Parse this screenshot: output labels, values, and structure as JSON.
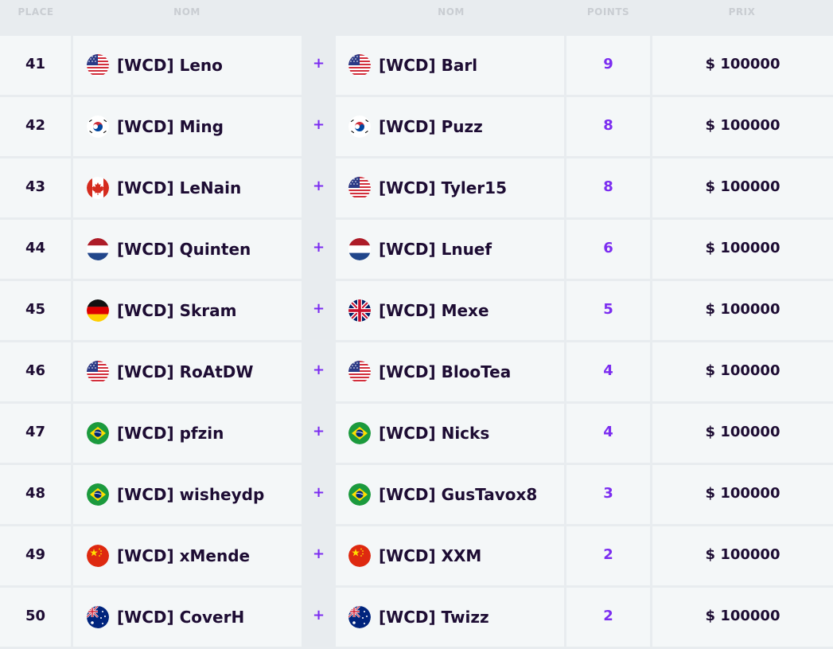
{
  "headers": {
    "place": "PLACE",
    "name1": "NOM",
    "name2": "NOM",
    "points": "POINTS",
    "prize": "PRIX"
  },
  "plus_symbol": "+",
  "rows": [
    {
      "place": "41",
      "p1": {
        "name": "[WCD] Leno",
        "flag": "us"
      },
      "p2": {
        "name": "[WCD] Barl",
        "flag": "us"
      },
      "points": "9",
      "prize": "$ 100000"
    },
    {
      "place": "42",
      "p1": {
        "name": "[WCD] Ming",
        "flag": "kr"
      },
      "p2": {
        "name": "[WCD] Puzz",
        "flag": "kr"
      },
      "points": "8",
      "prize": "$ 100000"
    },
    {
      "place": "43",
      "p1": {
        "name": "[WCD] LeNain",
        "flag": "ca"
      },
      "p2": {
        "name": "[WCD] Tyler15",
        "flag": "us"
      },
      "points": "8",
      "prize": "$ 100000"
    },
    {
      "place": "44",
      "p1": {
        "name": "[WCD] Quinten",
        "flag": "nl"
      },
      "p2": {
        "name": "[WCD] Lnuef",
        "flag": "nl"
      },
      "points": "6",
      "prize": "$ 100000"
    },
    {
      "place": "45",
      "p1": {
        "name": "[WCD] Skram",
        "flag": "de"
      },
      "p2": {
        "name": "[WCD] Mexe",
        "flag": "gb"
      },
      "points": "5",
      "prize": "$ 100000"
    },
    {
      "place": "46",
      "p1": {
        "name": "[WCD] RoAtDW",
        "flag": "us"
      },
      "p2": {
        "name": "[WCD] BlooTea",
        "flag": "us"
      },
      "points": "4",
      "prize": "$ 100000"
    },
    {
      "place": "47",
      "p1": {
        "name": "[WCD] pfzin",
        "flag": "br"
      },
      "p2": {
        "name": "[WCD] Nicks",
        "flag": "br"
      },
      "points": "4",
      "prize": "$ 100000"
    },
    {
      "place": "48",
      "p1": {
        "name": "[WCD] wisheydp",
        "flag": "br"
      },
      "p2": {
        "name": "[WCD] GusTavox8",
        "flag": "br"
      },
      "points": "3",
      "prize": "$ 100000"
    },
    {
      "place": "49",
      "p1": {
        "name": "[WCD] xMende",
        "flag": "cn"
      },
      "p2": {
        "name": "[WCD] XXM",
        "flag": "cn"
      },
      "points": "2",
      "prize": "$ 100000"
    },
    {
      "place": "50",
      "p1": {
        "name": "[WCD] CoverH",
        "flag": "au"
      },
      "p2": {
        "name": "[WCD] Twizz",
        "flag": "au"
      },
      "points": "2",
      "prize": "$ 100000"
    }
  ],
  "colors": {
    "accent": "#7b2cf0",
    "text": "#1d0c33",
    "row_bg": "#f4f7f8",
    "page_bg": "#e8ecef",
    "header_text": "#c9cdd2"
  }
}
